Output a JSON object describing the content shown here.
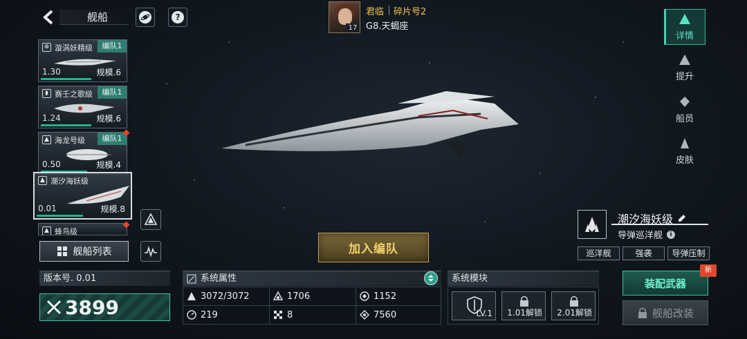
{
  "header": {
    "page_title": "舰船"
  },
  "player": {
    "name": "君临",
    "server": "碎片号2",
    "location": "G8.天蝎座",
    "level": "17"
  },
  "ship_list": [
    {
      "name": "漩涡妖精级",
      "fleet": "编队1",
      "version": "1.30",
      "scale": "规模.6",
      "progress": 0.6
    },
    {
      "name": "赛壬之歌级",
      "fleet": "编队1",
      "version": "1.24",
      "scale": "规模.6",
      "progress": 0.6
    },
    {
      "name": "海龙号级",
      "fleet": "编队1",
      "version": "0.50",
      "scale": "规模.4",
      "progress": 0.55
    },
    {
      "name": "潮汐海妖级",
      "fleet": "",
      "version": "0.01",
      "scale": "规模.8",
      "progress": 0.5
    },
    {
      "name": "蜂鸟级"
    }
  ],
  "ship_list_button": "舰船列表",
  "nav": {
    "details": "详情",
    "upgrade": "提升",
    "crew": "船员",
    "skin": "皮肤"
  },
  "ship": {
    "name": "潮汐海妖级",
    "type": "导弹巡洋舰",
    "traits": [
      "巡洋舰",
      "强袭",
      "导弹压制"
    ]
  },
  "join_fleet": "加入编队",
  "version_panel": {
    "label": "版本号. 0.01",
    "power": "3899"
  },
  "attributes_panel": {
    "title": "系统属性",
    "hp": "3072/3072",
    "armor": "1706",
    "shield": "1152",
    "speed": "219",
    "evasion": "8",
    "firepower": "7560"
  },
  "modules_panel": {
    "title": "系统模块",
    "slot1": "LV.1",
    "slot2": "1.01解锁",
    "slot3": "2.01解锁"
  },
  "buttons": {
    "equip": "装配武器",
    "new_badge": "新",
    "modify": "舰船改装"
  }
}
